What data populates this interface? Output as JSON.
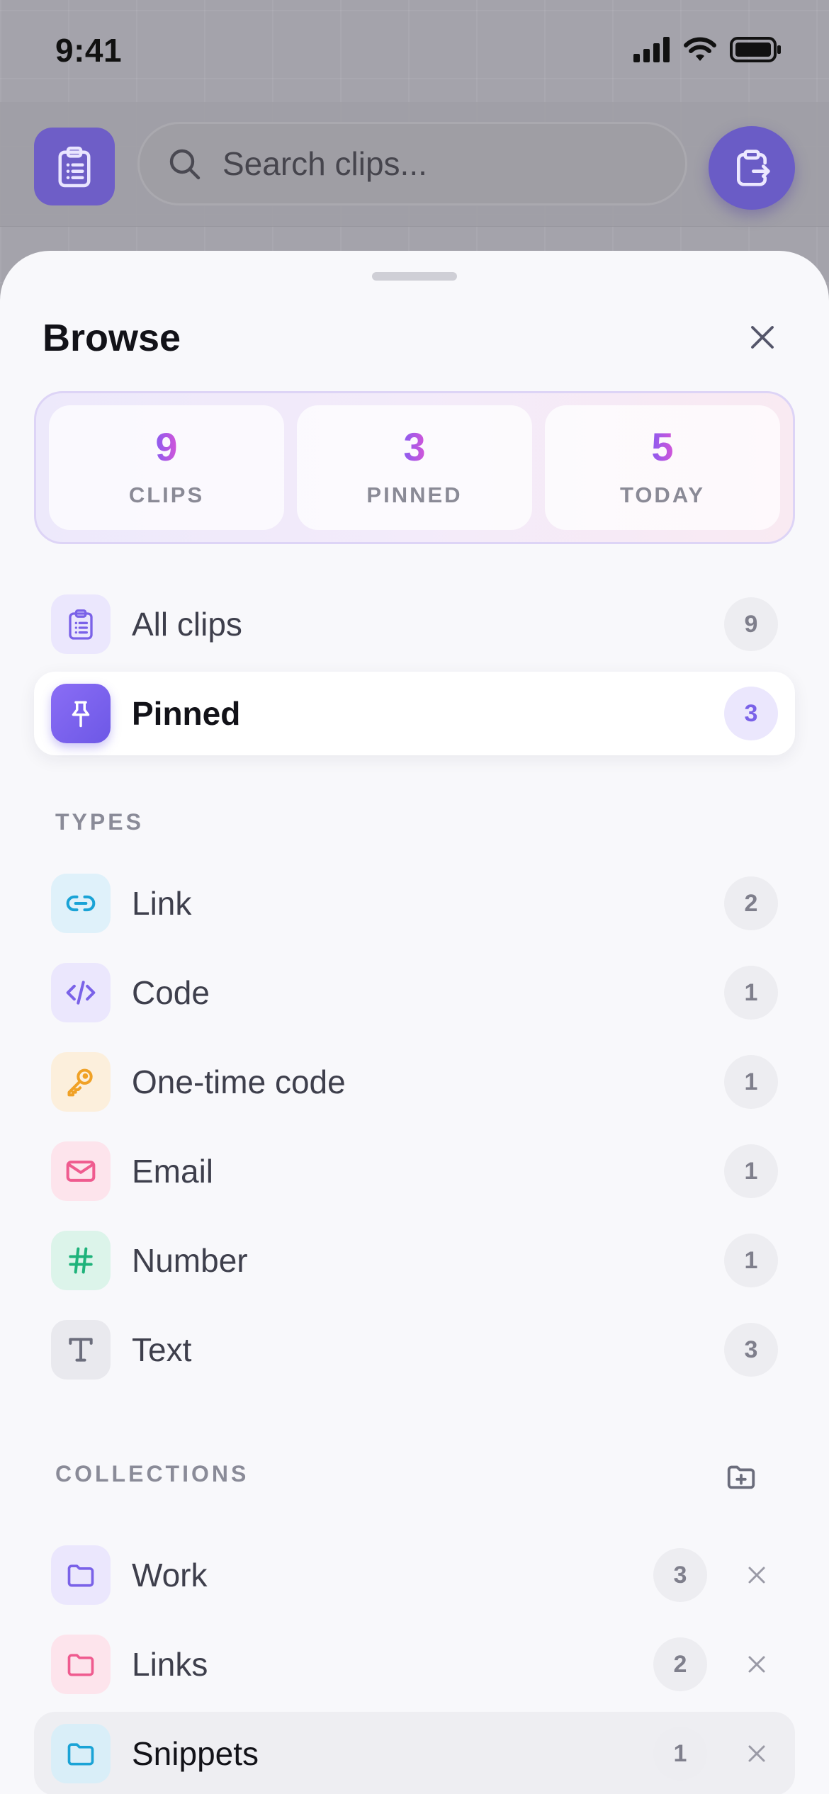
{
  "status": {
    "time": "9:41"
  },
  "search": {
    "placeholder": "Search clips..."
  },
  "sheet": {
    "title": "Browse",
    "stats": [
      {
        "value": "9",
        "label": "CLIPS"
      },
      {
        "value": "3",
        "label": "PINNED"
      },
      {
        "value": "5",
        "label": "TODAY"
      }
    ],
    "views": [
      {
        "label": "All clips",
        "count": "9",
        "icon": "clipboard-icon"
      },
      {
        "label": "Pinned",
        "count": "3",
        "icon": "pin-icon"
      }
    ],
    "types_label": "TYPES",
    "types": [
      {
        "label": "Link",
        "count": "2",
        "icon": "link-icon",
        "color": "#1aa3d6"
      },
      {
        "label": "Code",
        "count": "1",
        "icon": "code-icon",
        "color": "#7a62e8"
      },
      {
        "label": "One-time code",
        "count": "1",
        "icon": "key-icon",
        "color": "#f0a126"
      },
      {
        "label": "Email",
        "count": "1",
        "icon": "mail-icon",
        "color": "#ef5b8f"
      },
      {
        "label": "Number",
        "count": "1",
        "icon": "hash-icon",
        "color": "#1fb37b"
      },
      {
        "label": "Text",
        "count": "3",
        "icon": "text-icon",
        "color": "#6b6d7c"
      }
    ],
    "collections_label": "COLLECTIONS",
    "collections": [
      {
        "label": "Work",
        "count": "3",
        "icon": "folder-icon",
        "color": "#7a62e8"
      },
      {
        "label": "Links",
        "count": "2",
        "icon": "folder-icon",
        "color": "#ef5b8f"
      },
      {
        "label": "Snippets",
        "count": "1",
        "icon": "folder-icon",
        "color": "#1aa3d6"
      }
    ]
  },
  "colors": {
    "accent": "#7a62e8",
    "accent_gradient_end": "#d455d8",
    "sheet_bg": "#f8f8fb"
  }
}
